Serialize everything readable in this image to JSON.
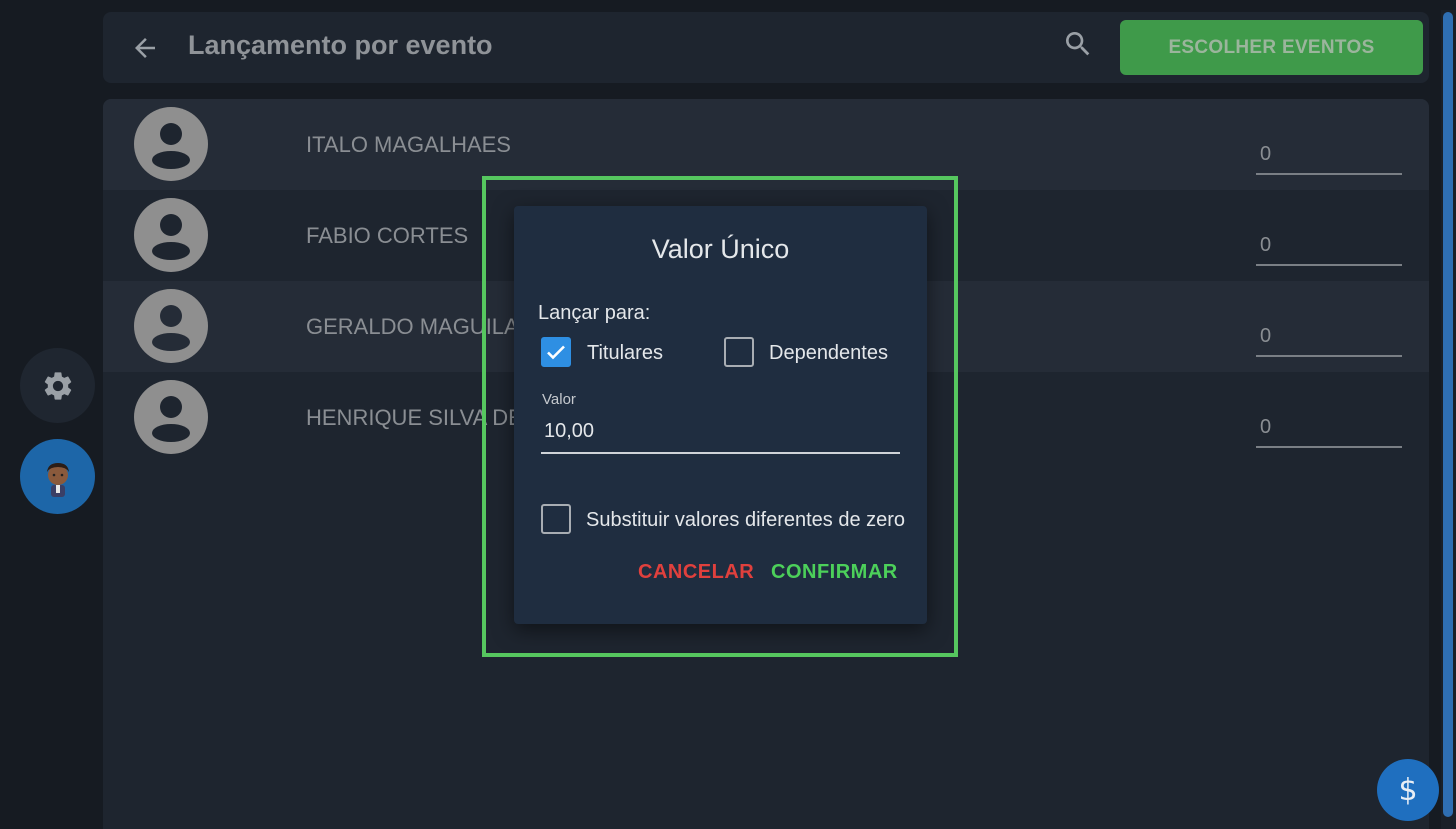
{
  "header": {
    "title": "Lançamento por evento",
    "back_icon": "arrow-left-icon",
    "search_icon": "search-icon",
    "choose_events_label": "ESCOLHER EVENTOS"
  },
  "people": [
    {
      "name": "ITALO MAGALHAES",
      "value": "0"
    },
    {
      "name": "FABIO CORTES",
      "value": "0"
    },
    {
      "name": "GERALDO MAGUILA",
      "value": "0"
    },
    {
      "name": "HENRIQUE SILVA DE",
      "value": "0"
    }
  ],
  "dialog": {
    "title": "Valor Único",
    "launch_for_label": "Lançar para:",
    "titulares_label": "Titulares",
    "titulares_checked": true,
    "dependentes_label": "Dependentes",
    "dependentes_checked": false,
    "valor_label": "Valor",
    "valor_value": "10,00",
    "substituir_label": "Substituir valores diferentes de zero",
    "substituir_checked": false,
    "cancel_label": "CANCELAR",
    "confirm_label": "CONFIRMAR"
  },
  "side": {
    "settings_icon": "gear-icon",
    "user_icon": "user-avatar-icon"
  },
  "fab": {
    "label": "$"
  },
  "colors": {
    "accent_green": "#3f9a4a",
    "checkbox_blue": "#2e8fe3",
    "cancel_red": "#e0403d",
    "confirm_green": "#4cd05a",
    "highlight": "#56c75f"
  }
}
